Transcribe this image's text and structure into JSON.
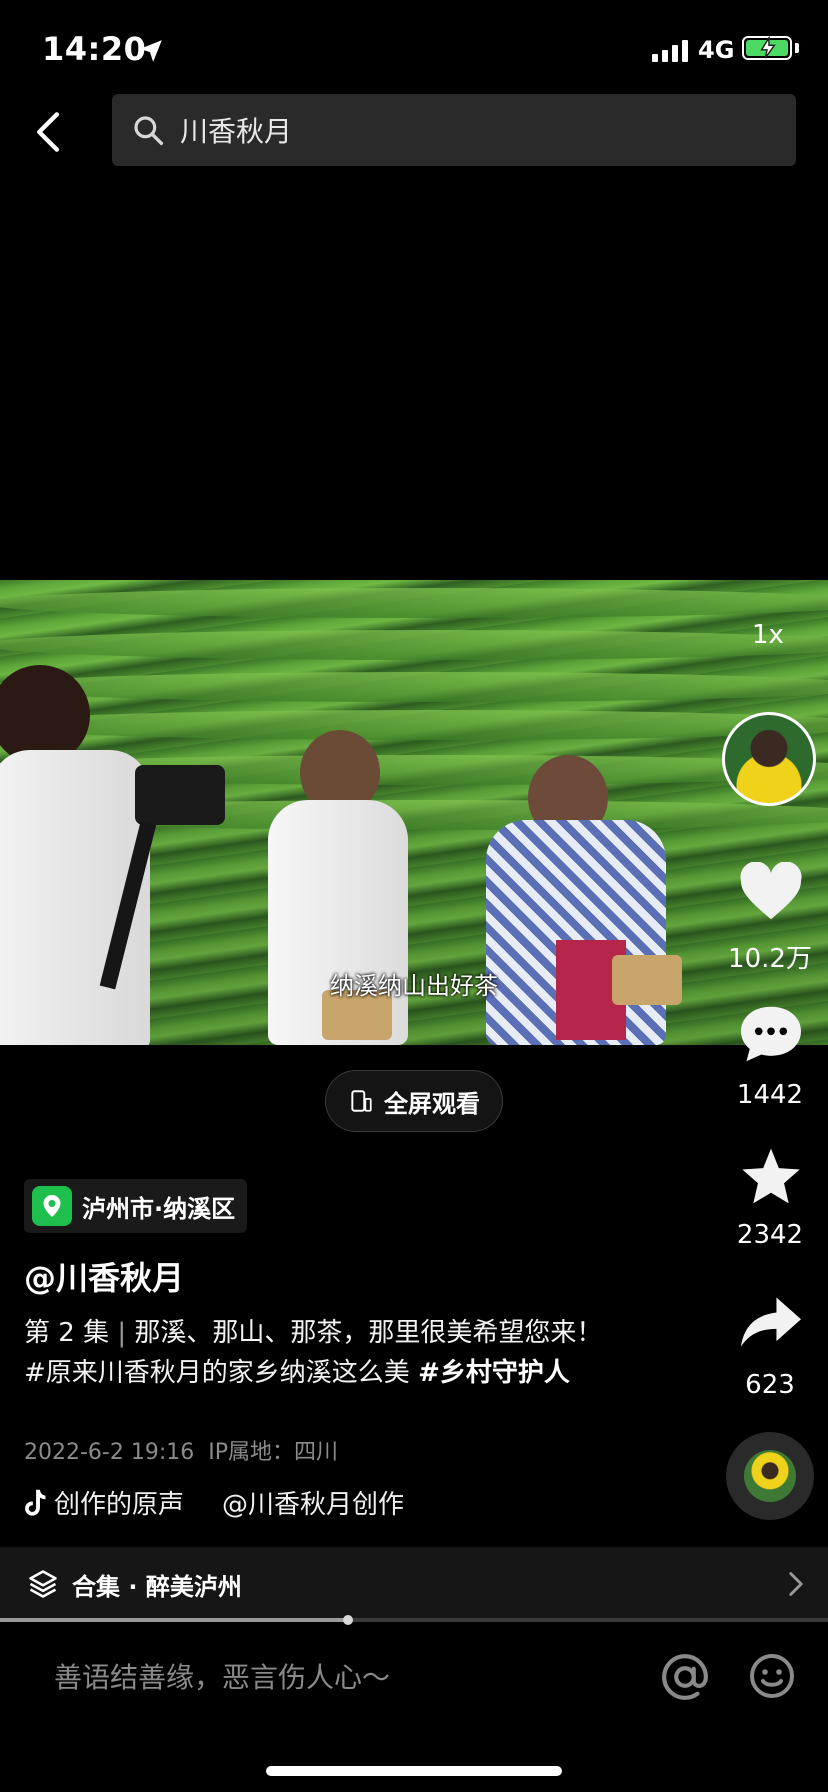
{
  "status_bar": {
    "time": "14:20",
    "network": "4G",
    "battery_charging": true
  },
  "header": {
    "search_query": "川香秋月",
    "back_icon": "chevron-left-icon",
    "search_icon": "search-icon"
  },
  "video": {
    "subtitle": "纳溪纳山出好茶"
  },
  "actions": {
    "speed": "1x",
    "like_count": "10.2万",
    "comment_count": "1442",
    "favorite_count": "2342",
    "share_count": "623"
  },
  "fullscreen": {
    "label": "全屏观看"
  },
  "info": {
    "location": "泸州市·纳溪区",
    "author": "@川香秋月",
    "description": {
      "episode": "第 2 集",
      "separator": "|",
      "text": " 那溪、那山、那茶，那里很美希望您来！",
      "tag1": "#原来川香秋月的家乡纳溪这么美",
      "tag2": "#乡村守护人"
    },
    "date": "2022-6-2 19:16",
    "ip": "IP属地：四川",
    "music_original": "创作的原声",
    "music_creator": "@川香秋月创作"
  },
  "collection": {
    "label": "合集 · 醉美泸州",
    "progress": 0.42
  },
  "comment_bar": {
    "placeholder": "善语结善缘，恶言伤人心～"
  },
  "colors": {
    "accent_green": "#1fbf4e",
    "battery_green": "#4cd964",
    "background": "#000000"
  }
}
